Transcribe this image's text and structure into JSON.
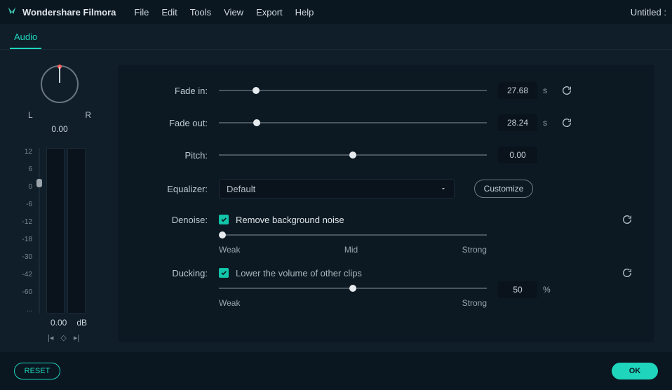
{
  "titlebar": {
    "product": "Wondershare Filmora",
    "menu": {
      "file": "File",
      "edit": "Edit",
      "tools": "Tools",
      "view": "View",
      "export": "Export",
      "help": "Help"
    },
    "doc": "Untitled :"
  },
  "tab": {
    "audio": "Audio"
  },
  "pan": {
    "left": "L",
    "right": "R",
    "value": "0.00"
  },
  "meter": {
    "ticks": [
      "12",
      "6",
      "0",
      "-6",
      "-12",
      "-18",
      "-30",
      "-42",
      "-60",
      "..."
    ],
    "db_value": "0.00",
    "db_unit": "dB"
  },
  "controls": {
    "fadein_label": "Fade in:",
    "fadein_value": "27.68",
    "fadein_unit": "s",
    "fadeout_label": "Fade out:",
    "fadeout_value": "28.24",
    "fadeout_unit": "s",
    "pitch_label": "Pitch:",
    "pitch_value": "0.00",
    "eq_label": "Equalizer:",
    "eq_value": "Default",
    "customize": "Customize",
    "denoise_label": "Denoise:",
    "denoise_check": "Remove background noise",
    "weak": "Weak",
    "mid": "Mid",
    "strong": "Strong",
    "ducking_label": "Ducking:",
    "ducking_check": "Lower the volume of other clips",
    "ducking_value": "50",
    "ducking_unit": "%"
  },
  "footer": {
    "reset": "RESET",
    "ok": "OK"
  }
}
